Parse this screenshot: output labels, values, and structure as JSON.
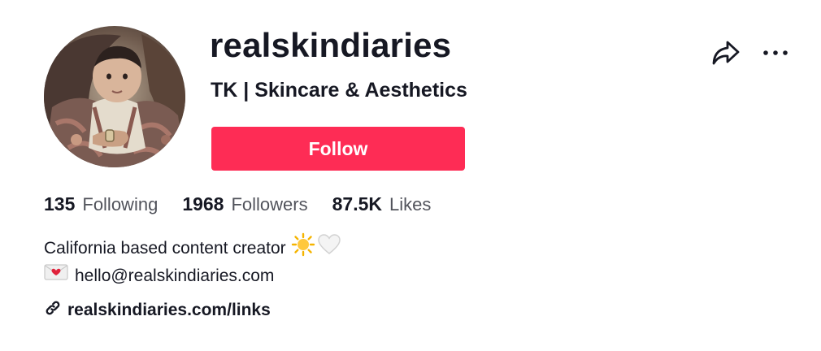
{
  "profile": {
    "username": "realskindiaries",
    "nickname": "TK | Skincare & Aesthetics",
    "avatar": "vintage-baby-photo"
  },
  "actions": {
    "follow_label": "Follow",
    "share_icon": "share-arrow-icon",
    "more_icon": "more-dots-icon"
  },
  "stats": [
    {
      "value": "135",
      "label": "Following"
    },
    {
      "value": "1968",
      "label": "Followers"
    },
    {
      "value": "87.5K",
      "label": "Likes"
    }
  ],
  "bio": {
    "line1": "California based content creator",
    "line1_emojis": [
      "sun-emoji",
      "white-heart-emoji"
    ],
    "line2_emoji": "love-letter-emoji",
    "line2": "hello@realskindiaries.com"
  },
  "link": {
    "icon": "link-icon",
    "text": "realskindiaries.com/links"
  },
  "colors": {
    "follow_bg": "#fe2c55",
    "text": "#161823",
    "muted": "#5c5d65"
  }
}
